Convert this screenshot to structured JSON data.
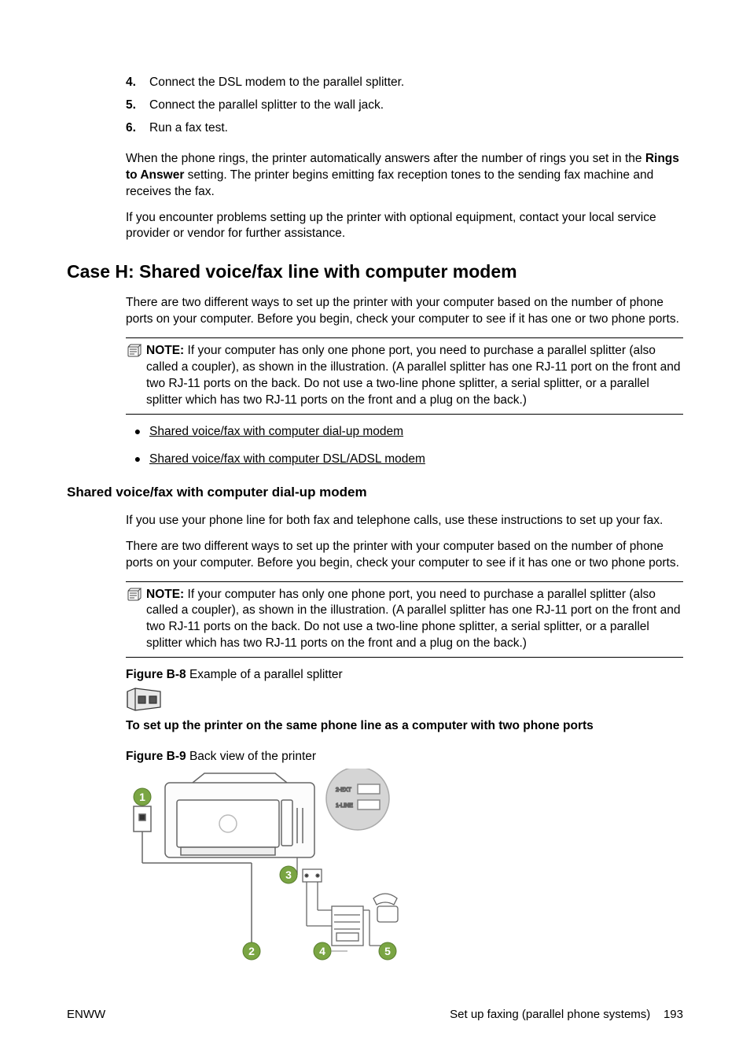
{
  "ol": {
    "n4": "4.",
    "t4": "Connect the DSL modem to the parallel splitter.",
    "n5": "5.",
    "t5": "Connect the parallel splitter to the wall jack.",
    "n6": "6.",
    "t6": "Run a fax test."
  },
  "para1_a": "When the phone rings, the printer automatically answers after the number of rings you set in the ",
  "para1_bold": "Rings to Answer",
  "para1_b": " setting. The printer begins emitting fax reception tones to the sending fax machine and receives the fax.",
  "para2": "If you encounter problems setting up the printer with optional equipment, contact your local service provider or vendor for further assistance.",
  "h2": "Case H: Shared voice/fax line with computer modem",
  "para3": "There are two different ways to set up the printer with your computer based on the number of phone ports on your computer. Before you begin, check your computer to see if it has one or two phone ports.",
  "note_label": "NOTE:",
  "note1": "If your computer has only one phone port, you need to purchase a parallel splitter (also called a coupler), as shown in the illustration. (A parallel splitter has one RJ-11 port on the front and two RJ-11 ports on the back. Do not use a two-line phone splitter, a serial splitter, or a parallel splitter which has two RJ-11 ports on the front and a plug on the back.)",
  "bullet1": "Shared voice/fax with computer dial-up modem",
  "bullet2": "Shared voice/fax with computer DSL/ADSL modem",
  "h3": "Shared voice/fax with computer dial-up modem",
  "para4": "If you use your phone line for both fax and telephone calls, use these instructions to set up your fax.",
  "para5": "There are two different ways to set up the printer with your computer based on the number of phone ports on your computer. Before you begin, check your computer to see if it has one or two phone ports.",
  "note2": "If your computer has only one phone port, you need to purchase a parallel splitter (also called a coupler), as shown in the illustration. (A parallel splitter has one RJ-11 port on the front and two RJ-11 ports on the back. Do not use a two-line phone splitter, a serial splitter, or a parallel splitter which has two RJ-11 ports on the front and a plug on the back.)",
  "figB8_num": "Figure B-8",
  "figB8_cap": "  Example of a parallel splitter",
  "setup_heading": "To set up the printer on the same phone line as a computer with two phone ports",
  "figB9_num": "Figure B-9",
  "figB9_cap": "  Back view of the printer",
  "diagram_labels": {
    "ext": "2-EXT",
    "line": "1-LINE",
    "c1": "1",
    "c2": "2",
    "c3": "3",
    "c4": "4",
    "c5": "5"
  },
  "footer_left": "ENWW",
  "footer_right_text": "Set up faxing (parallel phone systems)",
  "footer_page": "193"
}
